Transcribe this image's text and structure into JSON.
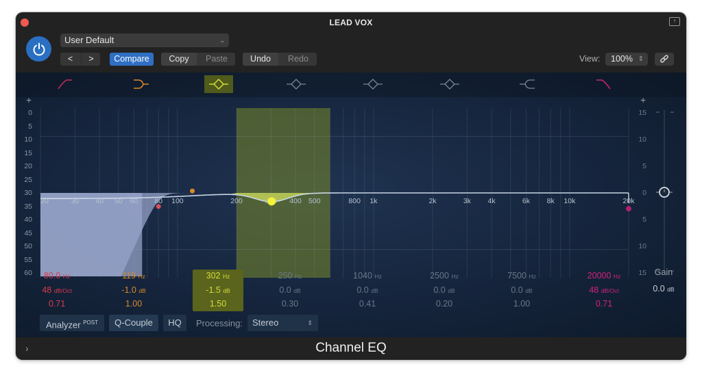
{
  "window": {
    "title": "LEAD VOX",
    "plugin_name": "Channel EQ"
  },
  "header": {
    "preset": "User Default",
    "prev_label": "<",
    "next_label": ">",
    "compare_label": "Compare",
    "copy_label": "Copy",
    "paste_label": "Paste",
    "undo_label": "Undo",
    "redo_label": "Redo",
    "view_label": "View:",
    "view_value": "100%"
  },
  "graph": {
    "left_scale": [
      "0",
      "5",
      "10",
      "15",
      "20",
      "25",
      "30",
      "35",
      "40",
      "45",
      "50",
      "55",
      "60"
    ],
    "right_scale": [
      "15",
      "10",
      "5",
      "0",
      "5",
      "10",
      "15"
    ],
    "freq_labels": [
      "20",
      "30",
      "40",
      "50",
      "60",
      "80",
      "100",
      "200",
      "300",
      "400",
      "500",
      "800",
      "1k",
      "2k",
      "3k",
      "4k",
      "6k",
      "8k",
      "10k",
      "20k"
    ],
    "selected_band": 3
  },
  "bands": [
    {
      "name": "Low Cut",
      "icon": "low-cut",
      "color": "#d83a4f",
      "freq": "80.0",
      "freq_unit": "Hz",
      "gain": "48",
      "gain_unit": "dB/Oct",
      "q": "0.71",
      "active": true
    },
    {
      "name": "Low Shelf",
      "icon": "low-shelf",
      "color": "#d8892a",
      "freq": "119",
      "freq_unit": "Hz",
      "gain": "-1.0",
      "gain_unit": "dB",
      "q": "1.00",
      "active": true
    },
    {
      "name": "Parametric 1",
      "icon": "bell",
      "color": "#d5dc3a",
      "freq": "302",
      "freq_unit": "Hz",
      "gain": "-1.5",
      "gain_unit": "dB",
      "q": "1.50",
      "active": true
    },
    {
      "name": "Parametric 2",
      "icon": "bell",
      "color": "#6b7787",
      "freq": "250",
      "freq_unit": "Hz",
      "gain": "0.0",
      "gain_unit": "dB",
      "q": "0.30",
      "active": false
    },
    {
      "name": "Parametric 3",
      "icon": "bell",
      "color": "#6b7787",
      "freq": "1040",
      "freq_unit": "Hz",
      "gain": "0.0",
      "gain_unit": "dB",
      "q": "0.41",
      "active": false
    },
    {
      "name": "Parametric 4",
      "icon": "bell",
      "color": "#6b7787",
      "freq": "2500",
      "freq_unit": "Hz",
      "gain": "0.0",
      "gain_unit": "dB",
      "q": "0.20",
      "active": false
    },
    {
      "name": "High Shelf",
      "icon": "high-shelf",
      "color": "#6b7787",
      "freq": "7500",
      "freq_unit": "Hz",
      "gain": "0.0",
      "gain_unit": "dB",
      "q": "1.00",
      "active": false
    },
    {
      "name": "High Cut",
      "icon": "high-cut",
      "color": "#d2237f",
      "freq": "20000",
      "freq_unit": "Hz",
      "gain": "48",
      "gain_unit": "dB/Oct",
      "q": "0.71",
      "active": true
    }
  ],
  "master": {
    "gain_label": "Gain",
    "gain_value": "0.0",
    "gain_unit": "dB"
  },
  "bottom": {
    "analyzer_label": "Analyzer",
    "analyzer_mode": "POST",
    "qcouple_label": "Q-Couple",
    "hq_label": "HQ",
    "processing_label": "Processing:",
    "processing_value": "Stereo"
  }
}
